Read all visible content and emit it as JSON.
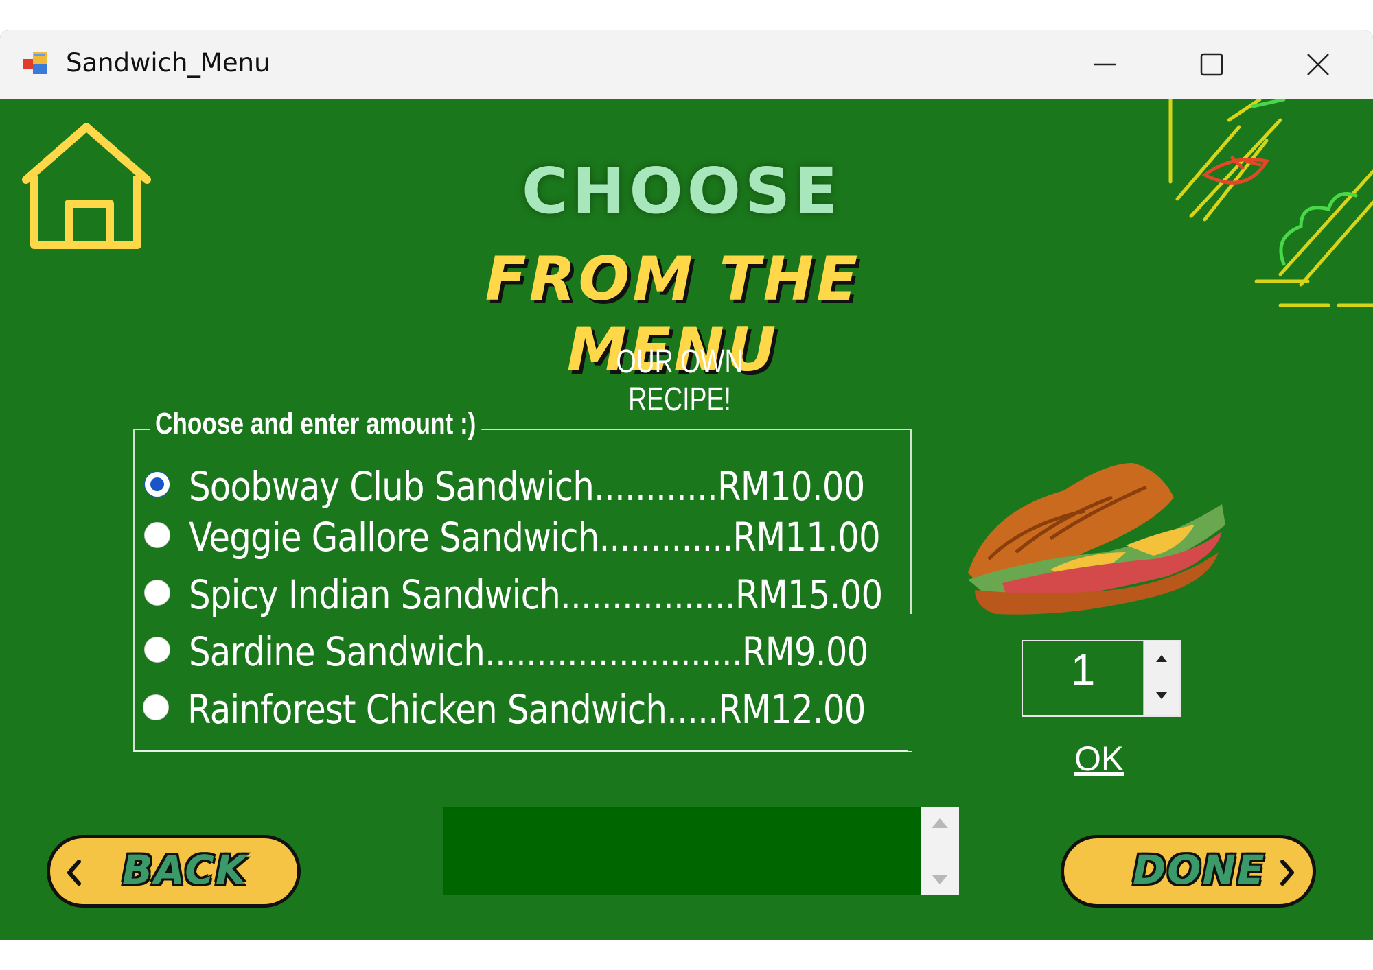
{
  "window": {
    "title": "Sandwich_Menu",
    "controls": {
      "minimize": "minimize-icon",
      "maximize": "maximize-icon",
      "close": "close-icon"
    }
  },
  "header": {
    "title_line1": "CHOOSE",
    "title_line2": "FROM THE MENU",
    "subtitle": "OUR OWN RECIPE!"
  },
  "menu": {
    "legend": "Choose and enter amount :)",
    "options": [
      {
        "label": "Soobway Club Sandwich............RM10.00",
        "selected": true
      },
      {
        "label": "Veggie Gallore Sandwich.............RM11.00",
        "selected": false
      },
      {
        "label": "Spicy Indian Sandwich.................RM15.00",
        "selected": false
      },
      {
        "label": "Sardine Sandwich.........................RM9.00",
        "selected": false
      },
      {
        "label": "Rainforest Chicken Sandwich.....RM12.00",
        "selected": false
      }
    ]
  },
  "quantity": {
    "value": "1"
  },
  "actions": {
    "ok": "OK",
    "back": "BACK",
    "done": "DONE"
  },
  "colors": {
    "background": "#1b771b",
    "accent_yellow": "#f6c445",
    "title_green": "#a8e6bb",
    "list_bg": "#006600"
  }
}
